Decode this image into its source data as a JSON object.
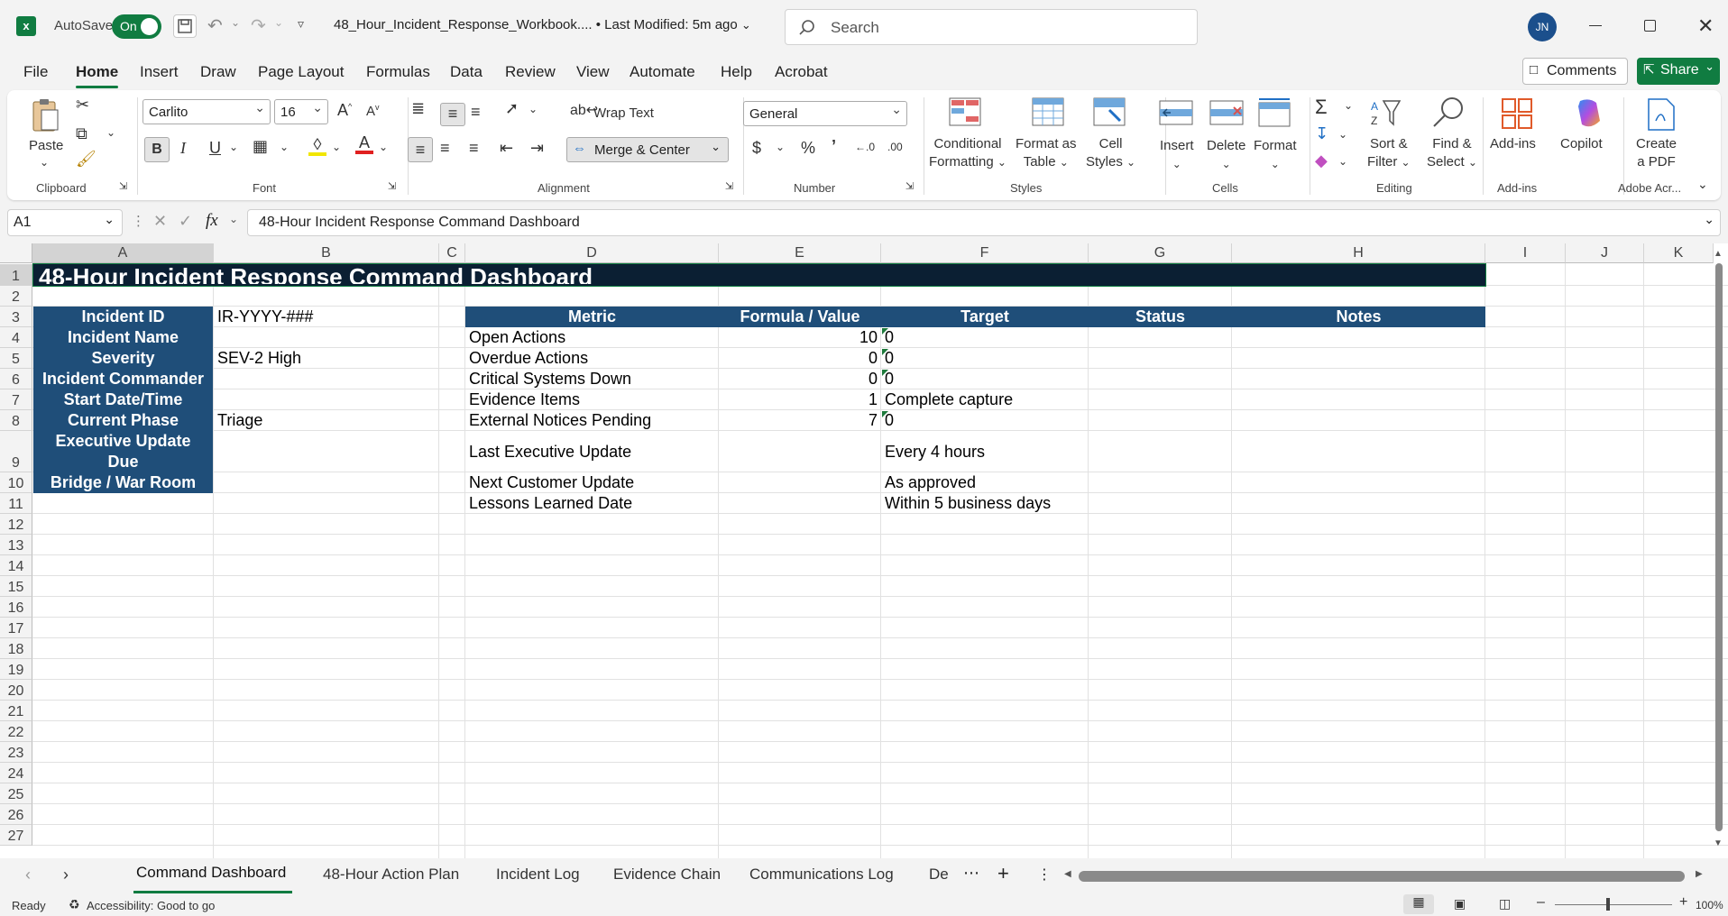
{
  "titlebar": {
    "autosave_label": "AutoSave",
    "autosave_state": "On",
    "doc_title": "48_Hour_Incident_Response_Workbook....  •  Last Modified: 5m ago",
    "search_placeholder": "Search",
    "avatar_initials": "JN"
  },
  "menu": {
    "items": [
      "File",
      "Home",
      "Insert",
      "Draw",
      "Page Layout",
      "Formulas",
      "Data",
      "Review",
      "View",
      "Automate",
      "Help",
      "Acrobat"
    ],
    "active": "Home",
    "comments": "Comments",
    "share": "Share"
  },
  "ribbon": {
    "clipboard": {
      "label": "Clipboard",
      "paste": "Paste"
    },
    "font": {
      "label": "Font",
      "family": "Carlito",
      "size": "16"
    },
    "alignment": {
      "label": "Alignment",
      "wrap_text": "Wrap Text",
      "merge_center": "Merge & Center"
    },
    "number": {
      "label": "Number",
      "format": "General"
    },
    "styles": {
      "label": "Styles",
      "conditional": "Conditional Formatting",
      "conditional_l1": "Conditional",
      "conditional_l2": "Formatting",
      "format_table_l1": "Format as",
      "format_table_l2": "Table",
      "cell_styles_l1": "Cell",
      "cell_styles_l2": "Styles"
    },
    "cells": {
      "label": "Cells",
      "insert": "Insert",
      "delete": "Delete",
      "format": "Format"
    },
    "editing": {
      "label": "Editing",
      "sort_l1": "Sort &",
      "sort_l2": "Filter",
      "find_l1": "Find &",
      "find_l2": "Select"
    },
    "addins": {
      "label": "Add-ins",
      "addins": "Add-ins",
      "copilot": "Copilot"
    },
    "adobe": {
      "label": "Adobe Acr...",
      "create_l1": "Create",
      "create_l2": "a PDF"
    }
  },
  "formula_bar": {
    "name_box": "A1",
    "content": "48-Hour Incident Response Command Dashboard"
  },
  "sheet": {
    "columns": [
      "A",
      "B",
      "C",
      "D",
      "E",
      "F",
      "G",
      "H",
      "I",
      "J",
      "K"
    ],
    "rows": [
      "1",
      "2",
      "3",
      "4",
      "5",
      "6",
      "7",
      "8",
      "9",
      "10",
      "11",
      "12",
      "13",
      "14",
      "15",
      "16",
      "17",
      "18",
      "19",
      "20",
      "21",
      "22",
      "23",
      "24",
      "25",
      "26",
      "27"
    ],
    "title": "48-Hour Incident Response Command Dashboard",
    "info_labels": [
      "Incident ID",
      "Incident Name",
      "Severity",
      "Incident Commander",
      "Start Date/Time",
      "Current Phase",
      "Executive Update",
      "Due",
      "Bridge / War Room"
    ],
    "info_values": {
      "incident_id": "IR-YYYY-###",
      "severity": "SEV-2 High",
      "phase": "Triage"
    },
    "metric_headers": [
      "Metric",
      "Formula / Value",
      "Target",
      "Status",
      "Notes"
    ],
    "metrics": [
      {
        "metric": "Open Actions",
        "value": "10",
        "target": "0"
      },
      {
        "metric": "Overdue Actions",
        "value": "0",
        "target": "0"
      },
      {
        "metric": "Critical Systems Down",
        "value": "0",
        "target": "0"
      },
      {
        "metric": "Evidence Items",
        "value": "1",
        "target": "Complete capture"
      },
      {
        "metric": "External Notices Pending",
        "value": "7",
        "target": "0"
      },
      {
        "metric": "Last Executive Update",
        "value": "",
        "target": "Every 4 hours"
      },
      {
        "metric": "Next Customer Update",
        "value": "",
        "target": "As approved"
      },
      {
        "metric": "Lessons Learned Date",
        "value": "",
        "target": "Within 5 business days"
      }
    ]
  },
  "tabs": {
    "items": [
      "Command Dashboard",
      "48-Hour Action Plan",
      "Incident Log",
      "Evidence Chain",
      "Communications Log",
      "De"
    ],
    "active": "Command Dashboard"
  },
  "status": {
    "ready": "Ready",
    "accessibility": "Accessibility: Good to go",
    "zoom": "100%"
  },
  "colors": {
    "accent": "#107c41",
    "header_fill": "#1f4e79",
    "title_fill": "#0b1f33"
  }
}
